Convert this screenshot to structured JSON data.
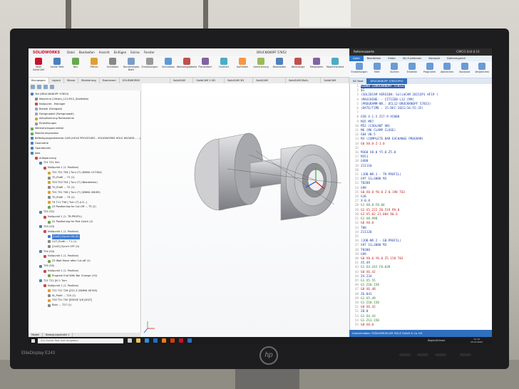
{
  "app": {
    "brand": "SOLIDWORKS",
    "menu": [
      "Datei",
      "Bearbeiten",
      "Ansicht",
      "Einfügen",
      "Extras",
      "Fenster"
    ],
    "document_title": "DRUCKKNOPF 57853",
    "ribbon": [
      {
        "label": "Über SolidCAM",
        "icon": "solidcam-icon",
        "color": "#c8102e"
      },
      {
        "label": "Letzte Teile",
        "icon": "recent-parts-icon",
        "color": "#4a7fc1"
      },
      {
        "label": "Neu",
        "icon": "new-icon",
        "color": "#6aa84f"
      },
      {
        "label": "Öffnen",
        "icon": "open-icon",
        "color": "#e0a030"
      },
      {
        "label": "Schließen",
        "icon": "close-doc-icon",
        "color": "#888888"
      },
      {
        "label": "Rechteckiges Blatt",
        "icon": "sheet-icon",
        "color": "#7a9cc9"
      },
      {
        "label": "Einstellungen",
        "icon": "settings-icon",
        "color": "#999999"
      },
      {
        "label": "Simulation",
        "icon": "simulation-icon",
        "color": "#5b9bd5"
      },
      {
        "label": "Werkzeugtabelle",
        "icon": "tool-table-icon",
        "color": "#c0504d"
      },
      {
        "label": "Planändern",
        "icon": "plan-icon",
        "color": "#8064a2"
      },
      {
        "label": "Drehteil",
        "icon": "lathe-icon",
        "color": "#4bacc6"
      },
      {
        "label": "Aufheben",
        "icon": "undo-icon",
        "color": "#f79646"
      },
      {
        "label": "Generierung",
        "icon": "generate-icon",
        "color": "#9bbb59"
      },
      {
        "label": "Bearbeiten",
        "icon": "edit-icon",
        "color": "#4f81bd"
      },
      {
        "label": "Werkzeuge",
        "icon": "tools-icon",
        "color": "#c0504d"
      },
      {
        "label": "Messtaster",
        "icon": "probe-icon",
        "color": "#8064a2"
      },
      {
        "label": "Maschinentest",
        "icon": "machine-test-icon",
        "color": "#4bacc6"
      }
    ],
    "tabs": [
      {
        "label": "Bezugsgeo",
        "active": true
      },
      {
        "label": "Layout",
        "active": false
      },
      {
        "label": "Skizze",
        "active": false
      },
      {
        "label": "Markierung",
        "active": false
      },
      {
        "label": "Evaluieren",
        "active": false
      },
      {
        "label": "SOLIDWORKS Zusatzanwendungen",
        "active": false
      },
      {
        "label": "SolidCAM Teil",
        "active": false
      },
      {
        "label": "SolidCAM 2.5D Jobs",
        "active": false
      },
      {
        "label": "SolidCAM 3D Jobs",
        "active": false
      },
      {
        "label": "SolidCAM iMachining",
        "active": false
      },
      {
        "label": "SolidCAM Multi-Achsen",
        "active": false
      },
      {
        "label": "SolidCAM Drehen",
        "active": false
      }
    ]
  },
  "tree": {
    "nodes": [
      {
        "label": "Teil (DRUCKKNOPF 57853)",
        "depth": 0,
        "color": "#4a7fc1"
      },
      {
        "label": "Maschine (Citizen_L12-M12_Stallkette)",
        "depth": 1,
        "color": "#888888"
      },
      {
        "label": "Nullpunkt - Manager",
        "depth": 1,
        "color": "#c0504d"
      },
      {
        "label": "Rohteil (Fertigteil)",
        "depth": 1,
        "color": "#8fa8c8"
      },
      {
        "label": "Fertigmodell (Fertigmodell)",
        "depth": 1,
        "color": "#8fa8c8"
      },
      {
        "label": "Aktualisierung Rohmaterial",
        "depth": 1,
        "color": "#e0a030"
      },
      {
        "label": "Einstellungen",
        "depth": 1,
        "color": "#999999"
      },
      {
        "label": "Werkstückspannmittel",
        "depth": 0,
        "color": "#6aa84f"
      },
      {
        "label": "Maschinenprozess",
        "depth": 0,
        "color": "#6aa84f"
      },
      {
        "label": "Befestigungselemente CAM (HOLE PROCESSES - SOLIDWORKS HOLE WIZARD - ...)",
        "depth": 0,
        "color": "#4a7fc1"
      },
      {
        "label": "Geometrie",
        "depth": 0,
        "color": "#4a7fc1"
      },
      {
        "label": "Operationen",
        "depth": 0,
        "color": "#4a7fc1"
      },
      {
        "label": "Jobs",
        "depth": 0,
        "color": "#4a7fc1"
      },
      {
        "label": "Aufspannung",
        "depth": 1,
        "color": "#c0504d"
      },
      {
        "label": "T01 T01 Sim",
        "depth": 2,
        "color": "#4a7fc1"
      },
      {
        "label": "Nullpunkt 1 (1- Position)",
        "depth": 3,
        "color": "#c0504d"
      },
      {
        "label": "T01 T01 T06 [ Turn (T) (DNMA 12T3X4)",
        "depth": 4,
        "color": "#e0a030"
      },
      {
        "label": "T0_Profil ... T1 (1)",
        "depth": 4,
        "color": "#888888"
      },
      {
        "label": "T03 T03 T04 [ Turn (T) (Bearbeiten)",
        "depth": 4,
        "color": "#e0a030"
      },
      {
        "label": "T0_Profil ... T2 (1)",
        "depth": 4,
        "color": "#888888"
      },
      {
        "label": "T01 T01 T06 [ Turn (T) (DNMA 45K85)",
        "depth": 4,
        "color": "#e0a030"
      },
      {
        "label": "T0_Profil ... T3 (1)",
        "depth": 4,
        "color": "#888888"
      },
      {
        "label": "T4 T11 T06 [ Turn (T) (L3...)",
        "depth": 4,
        "color": "#e0a030"
      },
      {
        "label": "23 Positioning for Cut-Off ... T3 (2)",
        "depth": 4,
        "color": "#6aa84f"
      },
      {
        "label": "T02 (S2)",
        "depth": 2,
        "color": "#4a7fc1"
      },
      {
        "label": "Nullpunkt 1 (1- TR-PROFIL)",
        "depth": 3,
        "color": "#c0504d"
      },
      {
        "label": "22 Positioning for Part Catch (2)",
        "depth": 4,
        "color": "#6aa84f"
      },
      {
        "label": "T03 (S3)",
        "depth": 2,
        "color": "#4a7fc1"
      },
      {
        "label": "Nullpunkt 1 (1- Position)",
        "depth": 3,
        "color": "#c0504d"
      },
      {
        "label": "[2x42] Synch ON (0)",
        "depth": 4,
        "color": "#3b7bd6",
        "selected": true
      },
      {
        "label": "CUT_Profil ... T1 (1)",
        "depth": 4,
        "color": "#888888"
      },
      {
        "label": "[2x42] Synch OFF (0)",
        "depth": 4,
        "color": "#888888"
      },
      {
        "label": "T04 (S4)",
        "depth": 2,
        "color": "#4a7fc1"
      },
      {
        "label": "Nullpunkt 1 (1- Position)",
        "depth": 3,
        "color": "#c0504d"
      },
      {
        "label": "23 Wait Move after Cut-off (1)",
        "depth": 4,
        "color": "#6aa84f"
      },
      {
        "label": "T05 (S5)",
        "depth": 2,
        "color": "#4a7fc1"
      },
      {
        "label": "Nullpunkt 1 (1- Position)",
        "depth": 3,
        "color": "#c0504d"
      },
      {
        "label": "Program End With Bar Change (10)",
        "depth": 4,
        "color": "#6aa84f"
      },
      {
        "label": "T21 T21 [Kl 1 Turn",
        "depth": 2,
        "color": "#4a7fc1"
      },
      {
        "label": "Nullpunkt 1 (1- Position)",
        "depth": 3,
        "color": "#c0504d"
      },
      {
        "label": "T21 T21 T26 [Z21 Z (DNMA 4K763)",
        "depth": 4,
        "color": "#e0a030"
      },
      {
        "label": "St_Profil ... T25 (1)",
        "depth": 4,
        "color": "#888888"
      },
      {
        "label": "T30 T21 T30 [EDSSE 3/6 [D3/T]",
        "depth": 4,
        "color": "#e0a030"
      },
      {
        "label": "Bohr ... T27 (1)",
        "depth": 4,
        "color": "#888888"
      }
    ],
    "bottom_tabs": [
      "Modell",
      "Bewegungsstudie 1"
    ]
  },
  "editor": {
    "window_title": "Referenzwerte",
    "app_name": "CIMCO Edit 8.10",
    "menu": [
      {
        "label": "Datei",
        "active": true
      },
      {
        "label": "Bearbeiten",
        "active": false
      },
      {
        "label": "Editor",
        "active": false
      },
      {
        "label": "NC-Funktionen",
        "active": false
      },
      {
        "label": "Backplot",
        "active": false
      },
      {
        "label": "Dateivergleich",
        "active": false
      }
    ],
    "ribbon": [
      {
        "label": "Einstellungen",
        "icon": "settings-icon"
      },
      {
        "label": "Hilfe",
        "icon": "help-icon"
      },
      {
        "label": "Suchen",
        "icon": "find-icon"
      },
      {
        "label": "Ersetzen",
        "icon": "replace-icon"
      },
      {
        "label": "Programm",
        "icon": "program-icon"
      },
      {
        "label": "Abbrechen",
        "icon": "cancel-icon"
      },
      {
        "label": "Backplot",
        "icon": "backplot-icon"
      },
      {
        "label": "Vergleichen",
        "icon": "compare-icon"
      }
    ],
    "tabs": [
      {
        "label": "NC Root",
        "active": false
      },
      {
        "label": "DRUCKKNOPF 57853.PRG",
        "active": true
      }
    ],
    "code": [
      {
        "ln": "1",
        "text": "%1000 (DRUCKKNOPF 57853)",
        "cls": "c-hl"
      },
      {
        "ln": "2",
        "text": "$1",
        "cls": ""
      },
      {
        "ln": "3",
        "text": "(SOLIDCAM VERSION: SolidCAM 2021SP1 HF19 )",
        "cls": "c-blue"
      },
      {
        "ln": "4",
        "text": "(MASCHINE: - CITIZEN L12 [M9]",
        "cls": "c-blue"
      },
      {
        "ln": "5",
        "text": "(PROGRAMM-NR.: DCL12-DRUCKKNOPF 57853)",
        "cls": "c-blue"
      },
      {
        "ln": "6",
        "text": "(DATE/TIME : 15-DEC-2021/10:55:35)",
        "cls": "c-blue"
      },
      {
        "ln": "7",
        "text": "",
        "cls": ""
      },
      {
        "ln": "8",
        "text": "G50 X-1.5 Z17.9 A5000",
        "cls": "c-blue"
      },
      {
        "ln": "9",
        "text": "M35 M97",
        "cls": "c-blue"
      },
      {
        "ln": "10",
        "text": "M52 (COOLANT ON)",
        "cls": "c-blue"
      },
      {
        "ln": "11",
        "text": "M6 (M6 CLAMP CLOSE)",
        "cls": "c-blue"
      },
      {
        "ln": "12",
        "text": "G04 U0.5",
        "cls": "c-blue"
      },
      {
        "ln": "13",
        "text": "M3 (COMPLETE BAR EXCHANGE PROGRAM)",
        "cls": "c-blue"
      },
      {
        "ln": "14",
        "text": "G0 X8.0 Z-1.0",
        "cls": "c-red"
      },
      {
        "ln": "15",
        "text": "",
        "cls": ""
      },
      {
        "ln": "16",
        "text": "M360 X8.0 Y5.0 Z5.0",
        "cls": "c-blue"
      },
      {
        "ln": "17",
        "text": "M351",
        "cls": "c-blue"
      },
      {
        "ln": "18",
        "text": "G400",
        "cls": "c-blue"
      },
      {
        "ln": "19",
        "text": "Z11110",
        "cls": "c-blue"
      },
      {
        "ln": "20",
        "text": "",
        "cls": ""
      },
      {
        "ln": "21",
        "text": "(JOB-NR.1 - TR-PROFIL)",
        "cls": "c-blue"
      },
      {
        "ln": "22",
        "text": "G97 S1=3000 M3",
        "cls": "c-blue"
      },
      {
        "ln": "23",
        "text": "T0200",
        "cls": "c-blue"
      },
      {
        "ln": "24",
        "text": "G99",
        "cls": "c-blue"
      },
      {
        "ln": "25",
        "text": "G0 X8.0 Y0.0 Z-0.198 T02",
        "cls": "c-red"
      },
      {
        "ln": "26",
        "text": "G18",
        "cls": "c-blue"
      },
      {
        "ln": "27",
        "text": "X-0.8",
        "cls": "c-blue"
      },
      {
        "ln": "28",
        "text": "G1 X8.0 F0.04",
        "cls": "c-comment"
      },
      {
        "ln": "29",
        "text": "G2 X5.222 Z0.519 R9.0",
        "cls": "c-red"
      },
      {
        "ln": "30",
        "text": "G2 X5.02 Z1.084 R0.6",
        "cls": "c-red"
      },
      {
        "ln": "31",
        "text": "G1 X8.998",
        "cls": "c-comment"
      },
      {
        "ln": "32",
        "text": "G0 X8.0",
        "cls": "c-red"
      },
      {
        "ln": "33",
        "text": "T00",
        "cls": "c-blue"
      },
      {
        "ln": "34",
        "text": "Z11120",
        "cls": "c-blue"
      },
      {
        "ln": "35",
        "text": "",
        "cls": ""
      },
      {
        "ln": "36",
        "text": "(JOB-NR.2 - GB-PROFIL)",
        "cls": "c-blue"
      },
      {
        "ln": "37",
        "text": "G97 S1=3000 M3",
        "cls": "c-blue"
      },
      {
        "ln": "38",
        "text": "T0300",
        "cls": "c-blue"
      },
      {
        "ln": "39",
        "text": "G99",
        "cls": "c-blue"
      },
      {
        "ln": "40",
        "text": "G0 X8.0 Y0.0 Z5.158 T03",
        "cls": "c-red"
      },
      {
        "ln": "41",
        "text": "X5.49",
        "cls": "c-blue"
      },
      {
        "ln": "42",
        "text": "G1 X4.242 F0.039",
        "cls": "c-comment"
      },
      {
        "ln": "43",
        "text": "G0 X6.42",
        "cls": "c-red"
      },
      {
        "ln": "44",
        "text": "Z4.234",
        "cls": "c-blue"
      },
      {
        "ln": "45",
        "text": "G1 X5.55",
        "cls": "c-comment"
      },
      {
        "ln": "46",
        "text": "G1 Z10.158",
        "cls": "c-comment"
      },
      {
        "ln": "47",
        "text": "G0 X6.48",
        "cls": "c-red"
      },
      {
        "ln": "48",
        "text": "Z6.041",
        "cls": "c-blue"
      },
      {
        "ln": "49",
        "text": "G1 X5.49",
        "cls": "c-comment"
      },
      {
        "ln": "50",
        "text": "G1 Z10.158",
        "cls": "c-comment"
      },
      {
        "ln": "51",
        "text": "G0 X6.42",
        "cls": "c-red"
      },
      {
        "ln": "52",
        "text": "Z8.0",
        "cls": "c-blue"
      },
      {
        "ln": "53",
        "text": "G1 X4.43",
        "cls": "c-comment"
      },
      {
        "ln": "54",
        "text": "G1 Z13.158",
        "cls": "c-comment"
      },
      {
        "ln": "55",
        "text": "G0 X8.0",
        "cls": "c-red"
      }
    ],
    "status": "Lizenzinhaber: STÄHLEMUELLER HOLZ GmbH & Co. KG"
  },
  "status_left": "Teile DRUCKKNOPF 57853",
  "taskbar": {
    "search_placeholder": "Zur Suche Text hier eingeben",
    "apps": [
      {
        "icon": "task-view-icon",
        "color": "#cccccc"
      },
      {
        "icon": "explorer-icon",
        "color": "#f2c14e"
      },
      {
        "icon": "edge-icon",
        "color": "#2e8fd8"
      },
      {
        "icon": "outlook-icon",
        "color": "#1e6fc8"
      },
      {
        "icon": "firefox-icon",
        "color": "#f07a1a"
      },
      {
        "icon": "office-icon",
        "color": "#d83b01"
      },
      {
        "icon": "solidworks-icon",
        "color": "#c8102e"
      },
      {
        "icon": "cimco-icon",
        "color": "#2e6fbf"
      }
    ],
    "weather": "Regen/Schnee",
    "time": "11:14",
    "date": "15.12.2021"
  },
  "monitor": {
    "brand": "EliteDisplay E243",
    "logo": "hp"
  }
}
